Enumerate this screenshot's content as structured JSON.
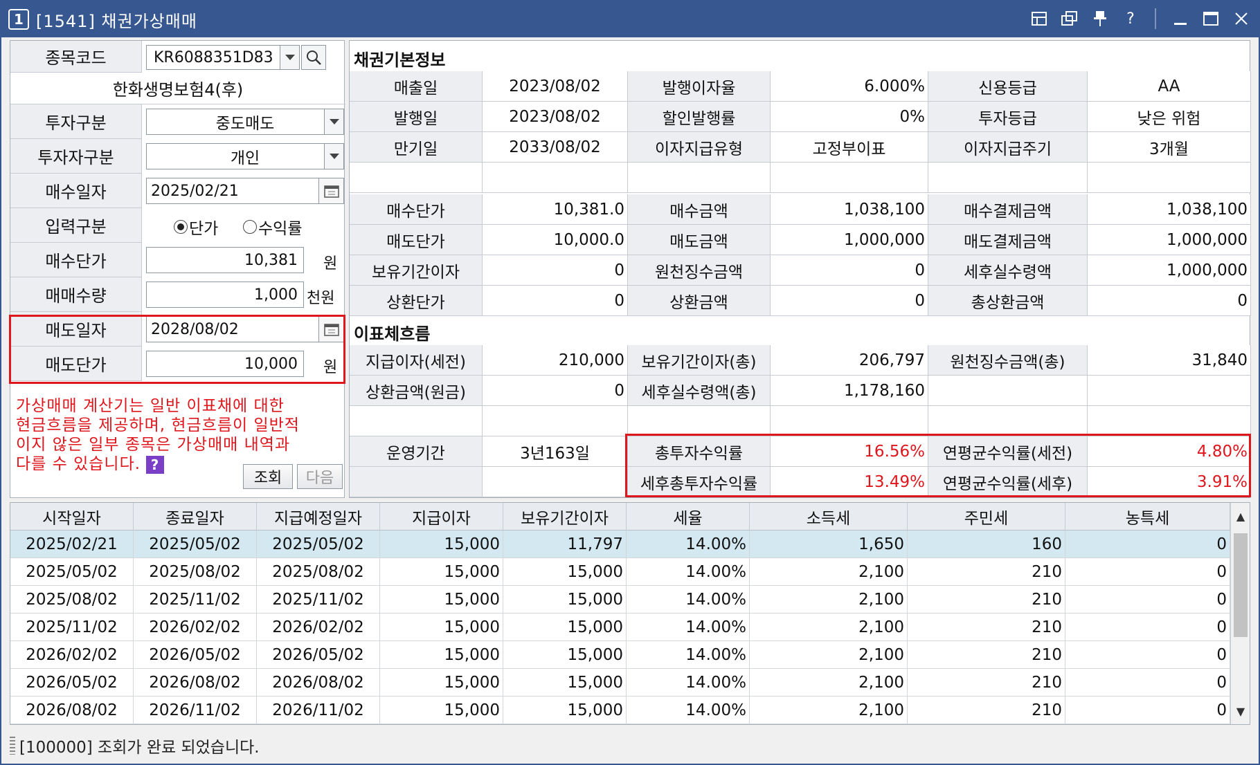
{
  "title": {
    "num": "1",
    "text": "[1541] 채권가상매매"
  },
  "left": {
    "code_label": "종목코드",
    "code_value": "KR6088351D83",
    "bond_name": "한화생명보험4(후)",
    "invest_type_label": "투자구분",
    "invest_type_value": "중도매도",
    "investor_type_label": "투자자구분",
    "investor_type_value": "개인",
    "buy_date_label": "매수일자",
    "buy_date_value": "2025/02/21",
    "input_type_label": "입력구분",
    "radio_price": "단가",
    "radio_yield": "수익률",
    "buy_price_label": "매수단가",
    "buy_price_value": "10,381",
    "buy_price_unit": "원",
    "qty_label": "매매수량",
    "qty_value": "1,000",
    "qty_unit": "천원",
    "sell_date_label": "매도일자",
    "sell_date_value": "2028/08/02",
    "sell_price_label": "매도단가",
    "sell_price_value": "10,000",
    "sell_price_unit": "원",
    "note_lines": [
      "가상매매 계산기는 일반 이표채에 대한",
      "현금흐름을 제공하며, 현금흐름이 일반적",
      "이지 않은 일부 종목은 가상매매 내역과",
      "다를 수 있습니다."
    ],
    "help_label": "?",
    "query_button": "조회",
    "next_button": "다음"
  },
  "right": {
    "section1": "채권기본정보",
    "basic": [
      [
        "매출일",
        "2023/08/02",
        "발행이자율",
        "6.000%",
        "신용등급",
        "AA"
      ],
      [
        "발행일",
        "2023/08/02",
        "할인발행률",
        "0%",
        "투자등급",
        "낮은 위험"
      ],
      [
        "만기일",
        "2033/08/02",
        "이자지급유형",
        "고정부이표",
        "이자지급주기",
        "3개월"
      ]
    ],
    "trade": [
      [
        "매수단가",
        "10,381.0",
        "매수금액",
        "1,038,100",
        "매수결제금액",
        "1,038,100"
      ],
      [
        "매도단가",
        "10,000.0",
        "매도금액",
        "1,000,000",
        "매도결제금액",
        "1,000,000"
      ],
      [
        "보유기간이자",
        "0",
        "원천징수금액",
        "0",
        "세후실수령액",
        "1,000,000"
      ],
      [
        "상환단가",
        "0",
        "상환금액",
        "0",
        "총상환금액",
        "0"
      ]
    ],
    "section2": "이표체흐름",
    "flow": [
      [
        "지급이자(세전)",
        "210,000",
        "보유기간이자(총)",
        "206,797",
        "원천징수금액(총)",
        "31,840"
      ],
      [
        "상환금액(원금)",
        "0",
        "세후실수령액(총)",
        "1,178,160",
        "",
        ""
      ]
    ],
    "period_label": "운영기간",
    "period_value": "3년163일",
    "yields": [
      [
        "총투자수익률",
        "16.56%",
        "연평균수익률(세전)",
        "4.80%"
      ],
      [
        "세후총투자수익률",
        "13.49%",
        "연평균수익률(세후)",
        "3.91%"
      ]
    ]
  },
  "table": {
    "headers": [
      "시작일자",
      "종료일자",
      "지급예정일자",
      "지급이자",
      "보유기간이자",
      "세율",
      "소득세",
      "주민세",
      "농특세"
    ],
    "rows": [
      [
        "2025/02/21",
        "2025/05/02",
        "2025/05/02",
        "15,000",
        "11,797",
        "14.00%",
        "1,650",
        "160",
        "0"
      ],
      [
        "2025/05/02",
        "2025/08/02",
        "2025/08/02",
        "15,000",
        "15,000",
        "14.00%",
        "2,100",
        "210",
        "0"
      ],
      [
        "2025/08/02",
        "2025/11/02",
        "2025/11/02",
        "15,000",
        "15,000",
        "14.00%",
        "2,100",
        "210",
        "0"
      ],
      [
        "2025/11/02",
        "2026/02/02",
        "2026/02/02",
        "15,000",
        "15,000",
        "14.00%",
        "2,100",
        "210",
        "0"
      ],
      [
        "2026/02/02",
        "2026/05/02",
        "2026/05/02",
        "15,000",
        "15,000",
        "14.00%",
        "2,100",
        "210",
        "0"
      ],
      [
        "2026/05/02",
        "2026/08/02",
        "2026/08/02",
        "15,000",
        "15,000",
        "14.00%",
        "2,100",
        "210",
        "0"
      ],
      [
        "2026/08/02",
        "2026/11/02",
        "2026/11/02",
        "15,000",
        "15,000",
        "14.00%",
        "2,100",
        "210",
        "0"
      ]
    ]
  },
  "status": "[100000] 조회가 완료 되었습니다.",
  "colors": {
    "titlebar": "#36578f",
    "highlight": "#e0161d",
    "selected_row": "#d3e8f0",
    "help": "#7b3fc7"
  }
}
